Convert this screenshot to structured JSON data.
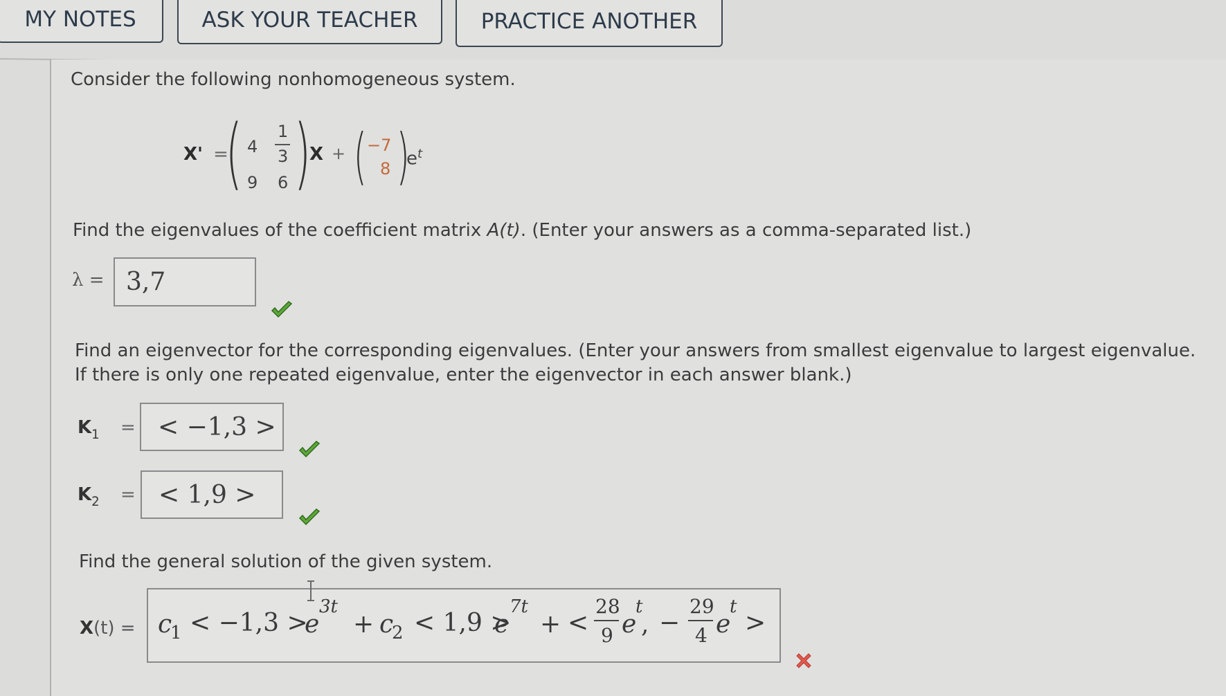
{
  "tabs": {
    "my_notes": "MY NOTES",
    "ask_teacher": "ASK YOUR TEACHER",
    "practice_another": "PRACTICE ANOTHER"
  },
  "problem": {
    "intro": "Consider the following nonhomogeneous system.",
    "equation": {
      "lhs": "X'",
      "equals": "=",
      "matrix": {
        "a11": "4",
        "a12_num": "1",
        "a12_den": "3",
        "a21": "9",
        "a22": "6"
      },
      "x_var": "X",
      "plus": "+",
      "forcing": {
        "f1": "−7",
        "f2": "8"
      },
      "exp_base": "e",
      "exp_power": "t"
    }
  },
  "part1": {
    "prompt": "Find the eigenvalues of the coefficient matrix A(t). (Enter your answers as a comma-separated list.)",
    "prompt_pre": "Find the eigenvalues of the coefficient matrix ",
    "prompt_math": "A(t)",
    "prompt_post": ". (Enter your answers as a comma-separated list.)",
    "label": "λ =",
    "value": "3,7",
    "status": "correct"
  },
  "part2": {
    "prompt_line1": "Find an eigenvector for the corresponding eigenvalues. (Enter your answers from smallest eigenvalue to largest eigenvalue.",
    "prompt_line2": "If there is only one repeated eigenvalue, enter the eigenvector in each answer blank.)",
    "k1": {
      "label": "K",
      "sub": "1",
      "eq": "=",
      "value": "< −1,3 >",
      "status": "correct"
    },
    "k2": {
      "label": "K",
      "sub": "2",
      "eq": "=",
      "value": "< 1,9 >",
      "status": "correct"
    }
  },
  "part3": {
    "prompt": "Find the general solution of the given system.",
    "label_bold": "X",
    "label_rest": "(t) =",
    "answer": {
      "c1": "c",
      "c1_sub": "1",
      "v1": "< −1,3 >",
      "e1": "e",
      "e1_pow": "3t",
      "plus1": "+",
      "c2": "c",
      "c2_sub": "2",
      "v2": "< 1,9 >",
      "e2": "e",
      "e2_pow": "7t",
      "plus2": "+",
      "open": "<",
      "f1_num": "28",
      "f1_den": "9",
      "e3": "e",
      "e3_pow": "t",
      "comma": ",",
      "minus": "−",
      "f2_num": "29",
      "f2_den": "4",
      "e4": "e",
      "e4_pow": "t",
      "close": ">"
    },
    "status": "incorrect"
  },
  "colors": {
    "correct": "#4f9a2e",
    "incorrect": "#d9534a",
    "forcing_vector": "#c46a3a"
  }
}
